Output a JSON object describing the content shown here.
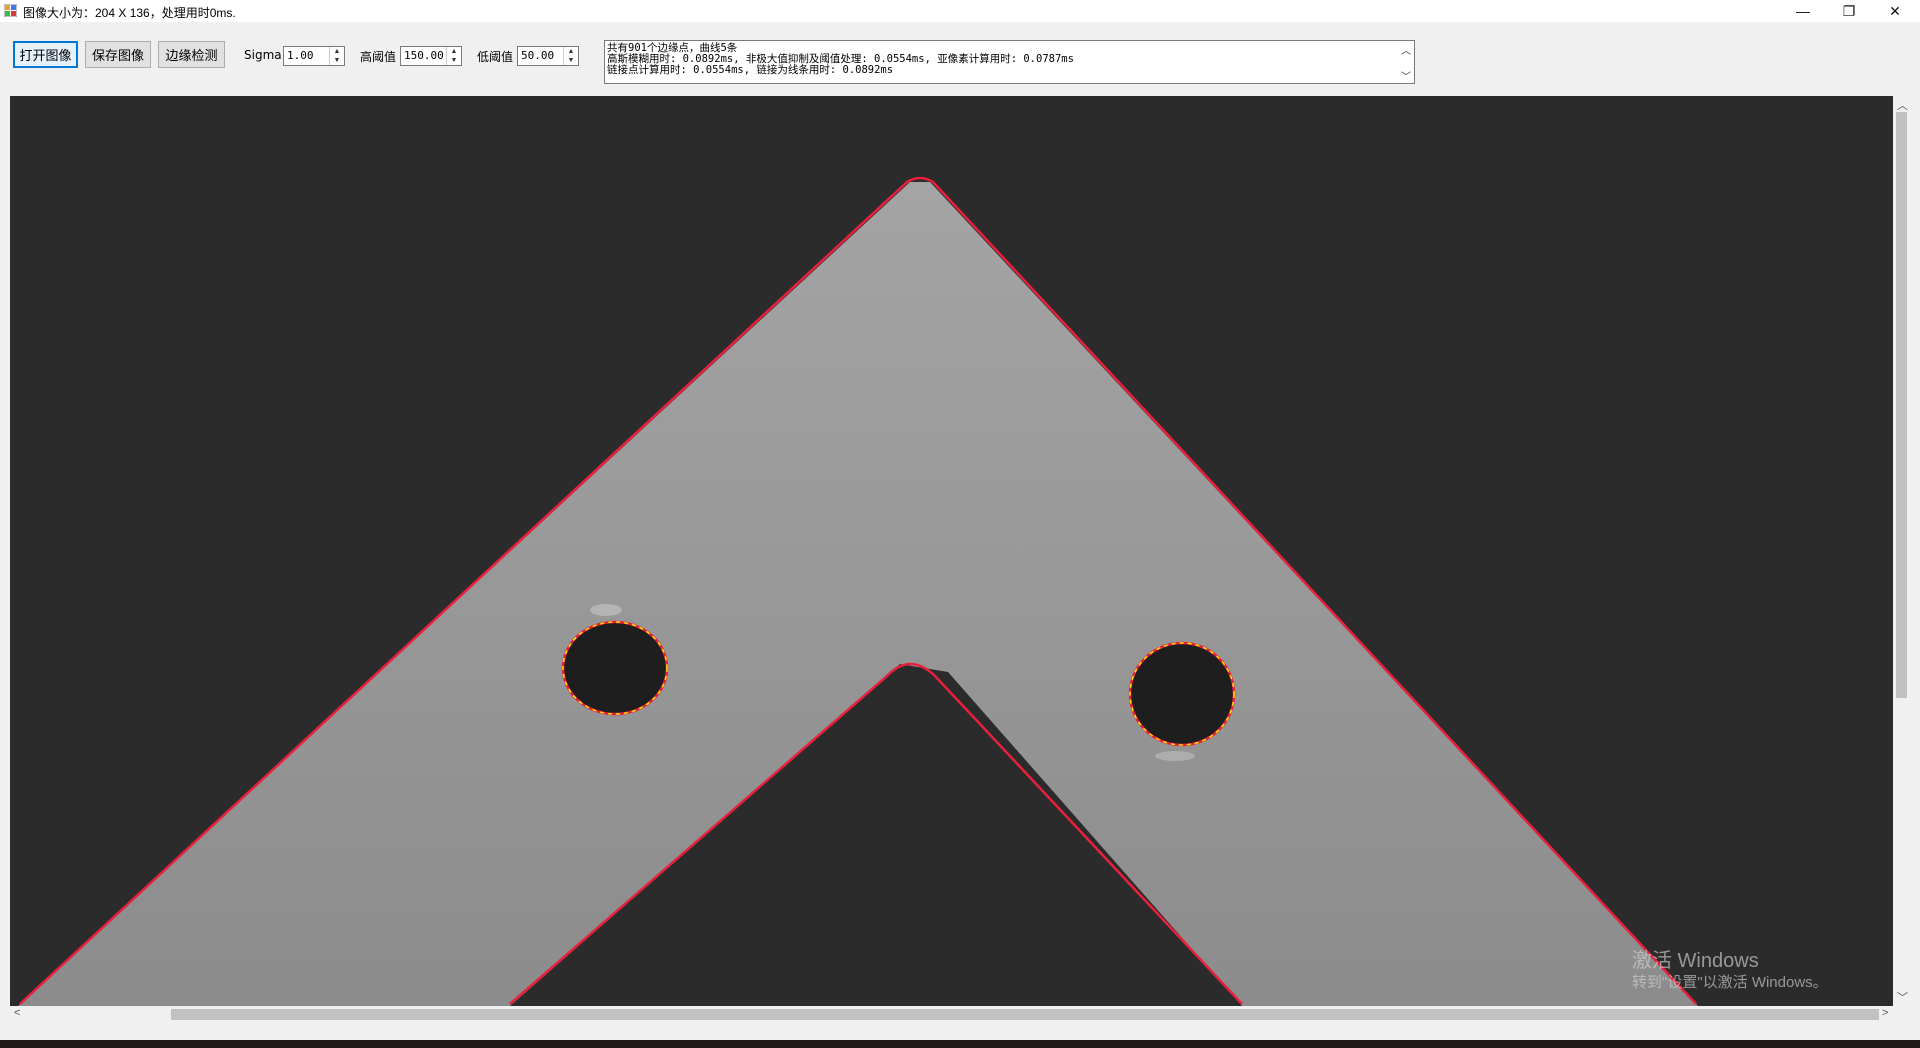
{
  "window": {
    "title": "图像大小为：204 X 136，处理用时0ms.",
    "minimize_glyph": "—",
    "restore_glyph": "❐",
    "close_glyph": "✕"
  },
  "toolbar": {
    "open_label": "打开图像",
    "save_label": "保存图像",
    "detect_label": "边缘检测",
    "sigma_label": "Sigma",
    "sigma_value": "1.00",
    "high_label": "高阈值",
    "high_value": "150.00",
    "low_label": "低阈值",
    "low_value": "50.00"
  },
  "log": {
    "lines": [
      "共有901个边缘点，曲线5条",
      "高斯模糊用时: 0.0892ms, 非极大值抑制及阈值处理: 0.0554ms, 亚像素计算用时: 0.0787ms",
      "链接点计算用时: 0.0554ms, 链接为线条用时: 0.0892ms"
    ]
  },
  "watermark": {
    "line1": "激活 Windows",
    "line2": "转到\"设置\"以激活 Windows。"
  },
  "colors": {
    "background": "#2b2b2b",
    "part": "#9a9a9a",
    "edge_red": "#e8203c",
    "edge_yellow": "#ffe400"
  }
}
